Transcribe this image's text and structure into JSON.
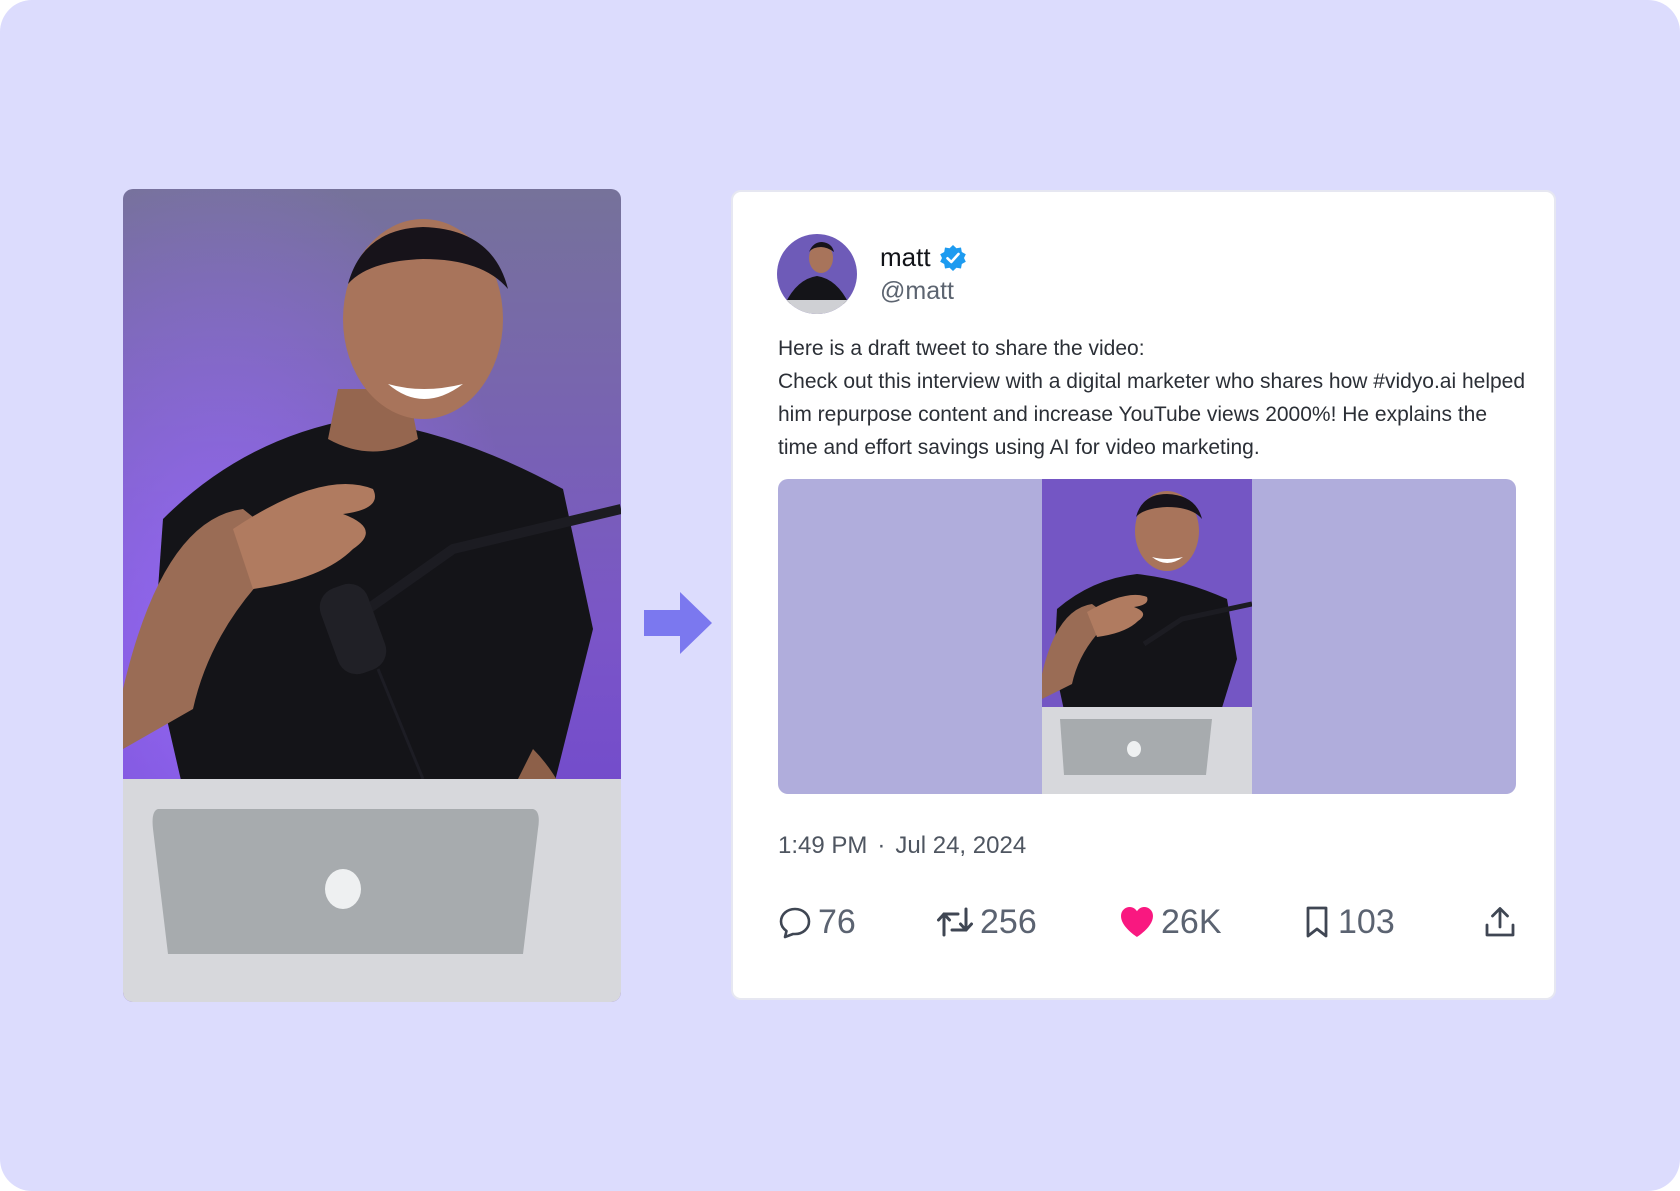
{
  "tweet": {
    "display_name": "matt",
    "handle": "@matt",
    "text_lines": [
      "Here is a draft tweet to share the video:",
      "Check out this interview with a digital marketer who shares how #vidyo.ai helped him repurpose content and increase YouTube views 2000%! He explains the time and effort savings using AI for video marketing."
    ],
    "time": "1:49 PM",
    "separator": "·",
    "date": "Jul 24, 2024"
  },
  "actions": {
    "replies": "76",
    "retweets": "256",
    "likes": "26K",
    "bookmarks": "103"
  },
  "icons": {
    "arrow": "arrow-right-icon",
    "verified": "verified-badge-icon",
    "reply": "speech-bubble-icon",
    "retweet": "retweet-icon",
    "like": "heart-icon",
    "bookmark": "bookmark-icon",
    "share": "upload-share-icon"
  },
  "colors": {
    "background": "#dcdcfd",
    "arrow": "#7b78ef",
    "verified": "#1d9bf0",
    "heart": "#f91880",
    "media_letterbox": "#b0addc"
  }
}
